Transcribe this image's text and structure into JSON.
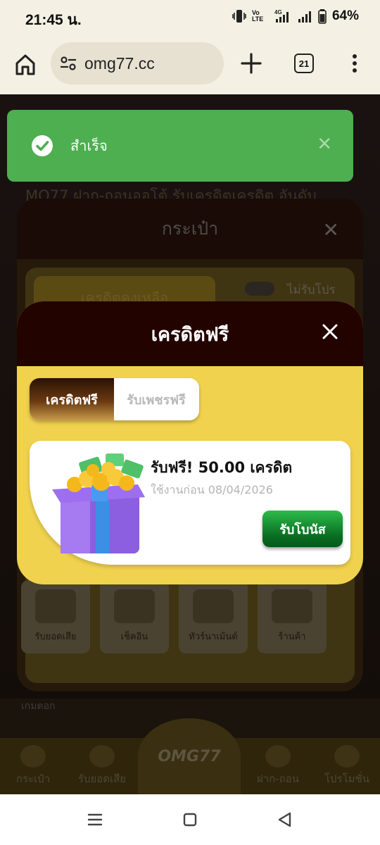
{
  "status_bar": {
    "time": "21:45 น.",
    "battery": "64%",
    "network": "4G",
    "volte": "VoLTE"
  },
  "browser": {
    "url": "omg77.cc",
    "tab_count": "21"
  },
  "background": {
    "marquee": "MO77 ฝาก-ถอนออโต้ รับเครดิตเครดิต อันดับ",
    "wallet_title": "กระเป๋า",
    "credit_label": "เครดิตคงเหลือ",
    "promo_toggle_label": "ไม่รับโปร",
    "tiles": [
      "รับยอดเสีย",
      "เช็คอิน",
      "ทัวร์นาเม้นต์",
      "ร้านค้า"
    ],
    "games_label": "เกมตอก",
    "nav": [
      "กระเป๋า",
      "รับยอดเสีย",
      "ฝาก-ถอน",
      "โปรโมชั่น"
    ],
    "logo": "OMG77"
  },
  "toast": {
    "message": "สำเร็จ"
  },
  "modal": {
    "title": "เครดิตฟรี",
    "tabs": [
      {
        "label": "เครดิตฟรี"
      },
      {
        "label": "รับเพชรฟรี"
      }
    ],
    "reward": {
      "title": "รับฟรี! 50.00 เครดิต",
      "expiry": "ใช้งานก่อน 08/04/2026",
      "button": "รับโบนัส"
    }
  },
  "colors": {
    "toast_green": "#4daf50",
    "modal_yellow": "#f0d24e",
    "modal_header": "#220300",
    "claim_green": "#0a6d22"
  }
}
